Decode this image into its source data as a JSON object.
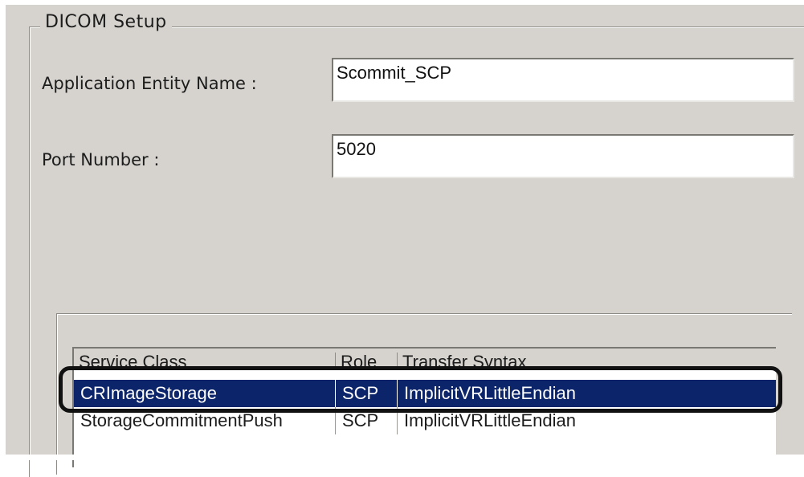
{
  "group": {
    "title": "DICOM Setup"
  },
  "ae": {
    "label": "Application Entity Name :",
    "value": "Scommit_SCP"
  },
  "port": {
    "label": "Port Number :",
    "value": "5020"
  },
  "table": {
    "columns": [
      "Service Class",
      "Role",
      "Transfer Syntax"
    ],
    "rows": [
      {
        "service": "CRImageStorage",
        "role": "SCP",
        "syntax": "ImplicitVRLittleEndian",
        "selected": true
      },
      {
        "service": "StorageCommitmentPush",
        "role": "SCP",
        "syntax": "ImplicitVRLittleEndian",
        "selected": false
      }
    ]
  }
}
